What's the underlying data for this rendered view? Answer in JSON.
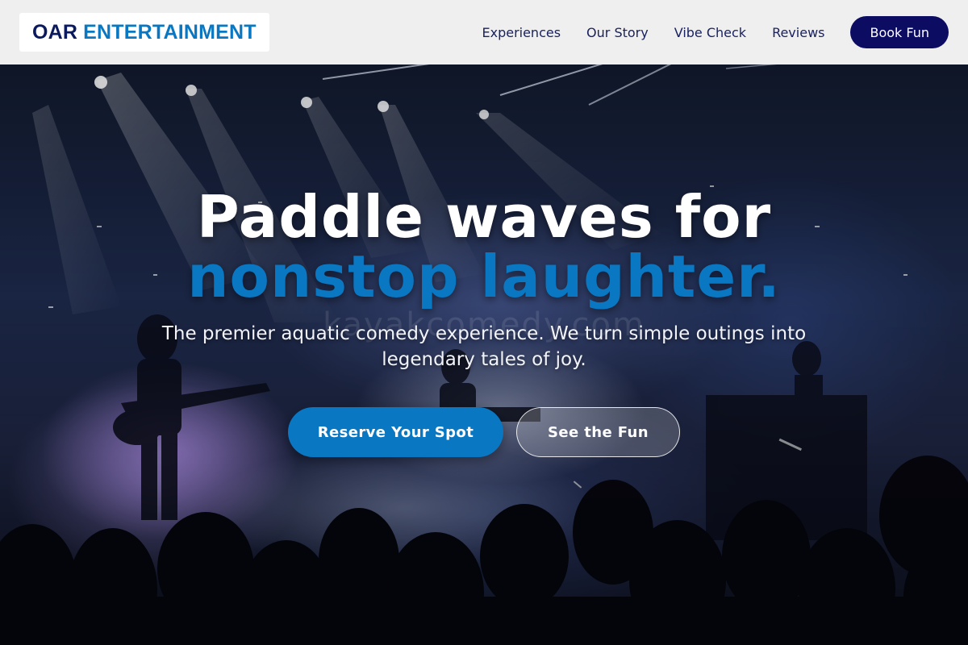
{
  "brand": {
    "logo_part1": "OAR",
    "logo_part2": "ENTERTAINMENT"
  },
  "nav": {
    "links": [
      {
        "label": "Experiences"
      },
      {
        "label": "Our Story"
      },
      {
        "label": "Vibe Check"
      },
      {
        "label": "Reviews"
      }
    ],
    "cta_label": "Book Fun"
  },
  "hero": {
    "headline_line1": "Paddle waves for",
    "headline_line2": "nonstop laughter.",
    "watermark": "kayakcomedy.com",
    "subtitle": "The premier aquatic comedy experience. We turn simple outings into legendary tales of joy.",
    "primary_cta": "Reserve Your Spot",
    "secondary_cta": "See the Fun",
    "background_image": "concert-stage-photo"
  },
  "colors": {
    "navy": "#0c0c63",
    "accent_blue": "#0a77c2",
    "nav_bg": "#efefef"
  }
}
